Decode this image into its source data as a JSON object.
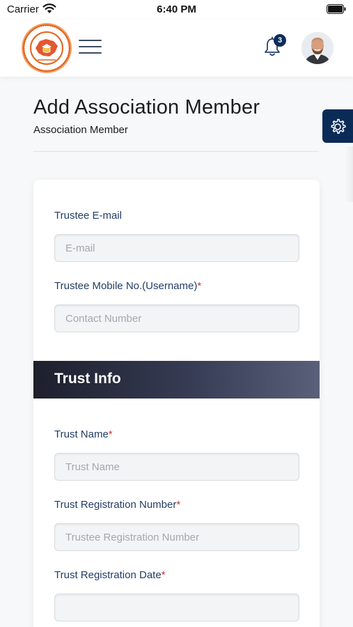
{
  "status_bar": {
    "carrier": "Carrier",
    "time": "6:40 PM"
  },
  "header": {
    "logo_icon": "organization-seal-logo",
    "menu_icon": "hamburger-menu-icon",
    "notification_icon": "bell-icon",
    "notification_count": "3",
    "avatar_icon": "user-avatar"
  },
  "page": {
    "title": "Add Association Member",
    "subtitle": "Association Member",
    "settings_icon": "gear-icon"
  },
  "form": {
    "trustee_email": {
      "label": "Trustee E-mail",
      "required_mark": "",
      "placeholder": "E-mail",
      "value": ""
    },
    "trustee_mobile": {
      "label": "Trustee Mobile No.(Username)",
      "required_mark": "*",
      "placeholder": "Contact Number",
      "value": ""
    },
    "section_trust_info": "Trust Info",
    "trust_name": {
      "label": "Trust Name",
      "required_mark": "*",
      "placeholder": "Trust Name",
      "value": ""
    },
    "trust_registration_number": {
      "label": "Trust Registration Number",
      "required_mark": "*",
      "placeholder": "Trustee Registration Number",
      "value": ""
    },
    "trust_registration_date": {
      "label": "Trust Registration Date",
      "required_mark": "*",
      "placeholder": "",
      "value": ""
    }
  },
  "colors": {
    "primary_navy": "#0b2b57",
    "label_blue": "#223d66",
    "required_red": "#d0312d",
    "logo_orange": "#e2641f"
  }
}
